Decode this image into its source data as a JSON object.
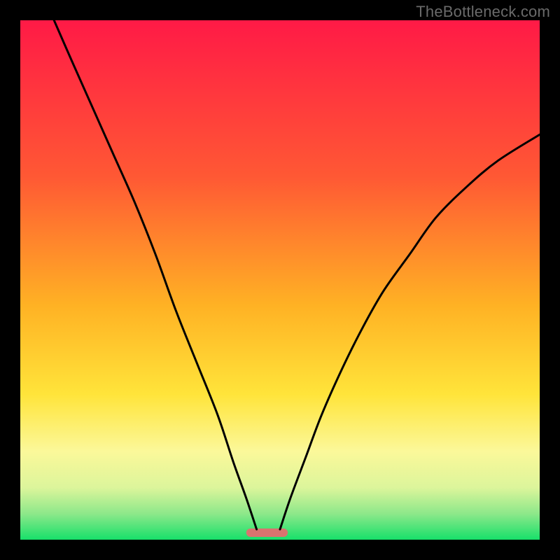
{
  "watermark": "TheBottleneck.com",
  "chart_data": {
    "type": "line",
    "title": "",
    "xlabel": "",
    "ylabel": "",
    "xlim": [
      0,
      100
    ],
    "ylim": [
      0,
      100
    ],
    "background_gradient": {
      "stops": [
        {
          "offset": 0.0,
          "color": "#ff1a46"
        },
        {
          "offset": 0.3,
          "color": "#ff5834"
        },
        {
          "offset": 0.55,
          "color": "#ffb224"
        },
        {
          "offset": 0.72,
          "color": "#ffe43a"
        },
        {
          "offset": 0.83,
          "color": "#fbf89a"
        },
        {
          "offset": 0.9,
          "color": "#dcf59b"
        },
        {
          "offset": 0.95,
          "color": "#8de88a"
        },
        {
          "offset": 1.0,
          "color": "#17e06a"
        }
      ]
    },
    "marker": {
      "x_center": 47.5,
      "width": 8,
      "color": "#d9746f"
    },
    "series": [
      {
        "name": "left-curve",
        "x": [
          6.5,
          10,
          14,
          18,
          22,
          26,
          30,
          34,
          38,
          41,
          43.5,
          45.5
        ],
        "y": [
          100,
          92,
          83,
          74,
          65,
          55,
          44,
          34,
          24,
          15,
          8,
          2
        ]
      },
      {
        "name": "right-curve",
        "x": [
          50,
          52,
          55,
          58,
          62,
          66,
          70,
          75,
          80,
          86,
          92,
          100
        ],
        "y": [
          2,
          8,
          16,
          24,
          33,
          41,
          48,
          55,
          62,
          68,
          73,
          78
        ]
      }
    ]
  }
}
